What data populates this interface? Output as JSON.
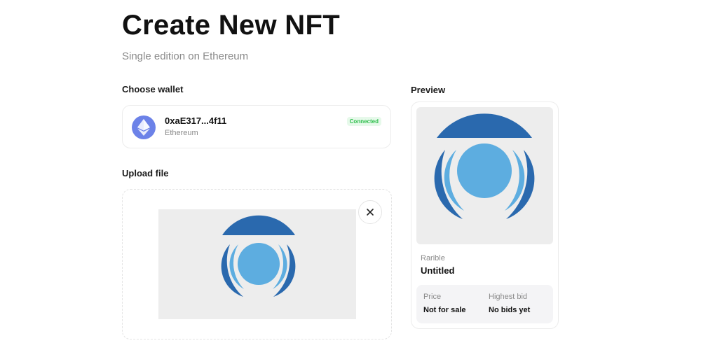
{
  "page": {
    "title": "Create New NFT",
    "subtitle": "Single edition on Ethereum"
  },
  "wallet_section": {
    "label": "Choose wallet",
    "address": "0xaE317...4f11",
    "network": "Ethereum",
    "status": "Connected",
    "icon": "ethereum-icon"
  },
  "upload_section": {
    "label": "Upload file",
    "close_icon": "close-icon"
  },
  "preview": {
    "label": "Preview",
    "collection": "Rarible",
    "name": "Untitled",
    "price_label": "Price",
    "price_value": "Not for sale",
    "bid_label": "Highest bid",
    "bid_value": "No bids yet"
  },
  "colors": {
    "artwork_dark_blue": "#2a69ae",
    "artwork_light_blue": "#5dade0",
    "artwork_background": "#ededed",
    "connected_green": "#2fbf4c",
    "eth_purple": "#6c82e8"
  }
}
